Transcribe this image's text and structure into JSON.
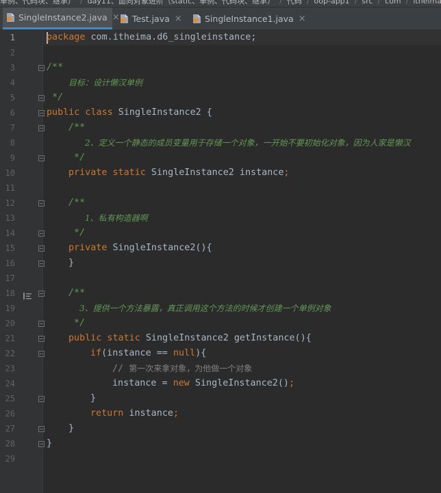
{
  "breadcrumb": [
    "单例、代码块、继承）",
    "day11、面向对象进阶（static、单例、代码块、继承）",
    "代码",
    "oop-app1",
    "src",
    "com",
    "itheima"
  ],
  "tabs": [
    {
      "label": "SingleInstance2.java",
      "active": true
    },
    {
      "label": "Test.java",
      "active": false
    },
    {
      "label": "SingleInstance1.java",
      "active": false
    }
  ],
  "tab_close_glyph": "×",
  "line_numbers": [
    "1",
    "2",
    "3",
    "4",
    "5",
    "6",
    "7",
    "8",
    "9",
    "10",
    "11",
    "12",
    "13",
    "14",
    "15",
    "16",
    "17",
    "18",
    "19",
    "20",
    "21",
    "22",
    "23",
    "24",
    "25",
    "26",
    "27",
    "28",
    "29"
  ],
  "code": {
    "l1_kw": "package",
    "l1_rest": " com.itheima.d6_singleinstance;",
    "l3": "/**",
    "l4": "目标：设计懒汉单例",
    "l5": " */",
    "l6_kw": "public class",
    "l6_rest": " SingleInstance2 {",
    "l7": "/**",
    "l8": "2、定义一个静态的成员变量用于存储一个对象，一开始不要初始化对象，因为人家是懒汉",
    "l9": " */",
    "l10_kw": "private static",
    "l10_rest": " SingleInstance2 instance",
    "l10_semi": ";",
    "l12": "/**",
    "l13": "1、私有构造器啊",
    "l14": " */",
    "l15_kw": "private",
    "l15_rest": " SingleInstance2(){",
    "l16": "}",
    "l18": "/**",
    "l19": "3、提供一个方法暴露，真正调用这个方法的时候才创建一个单例对象",
    "l20": " */",
    "l21_kw": "public static",
    "l21_rest": " SingleInstance2 getInstance(){",
    "l22_kw": "if",
    "l22_a": "(instance == ",
    "l22_null": "null",
    "l22_b": "){",
    "l23_slash": "// ",
    "l23_text": "第一次来拿对象，为他做一个对象",
    "l24_a": "instance = ",
    "l24_new": "new",
    "l24_b": " SingleInstance2()",
    "l24_semi": ";",
    "l25": "}",
    "l26_kw": "return",
    "l26_rest": " instance",
    "l26_semi": ";",
    "l27": "}",
    "l28": "}"
  },
  "colors": {
    "background": "#2b2b2b",
    "gutter": "#313335",
    "keyword": "#cc7832",
    "doc_comment": "#629755",
    "line_comment": "#808080",
    "text": "#a9b7c6",
    "tab_underline": "#4a88c7"
  }
}
